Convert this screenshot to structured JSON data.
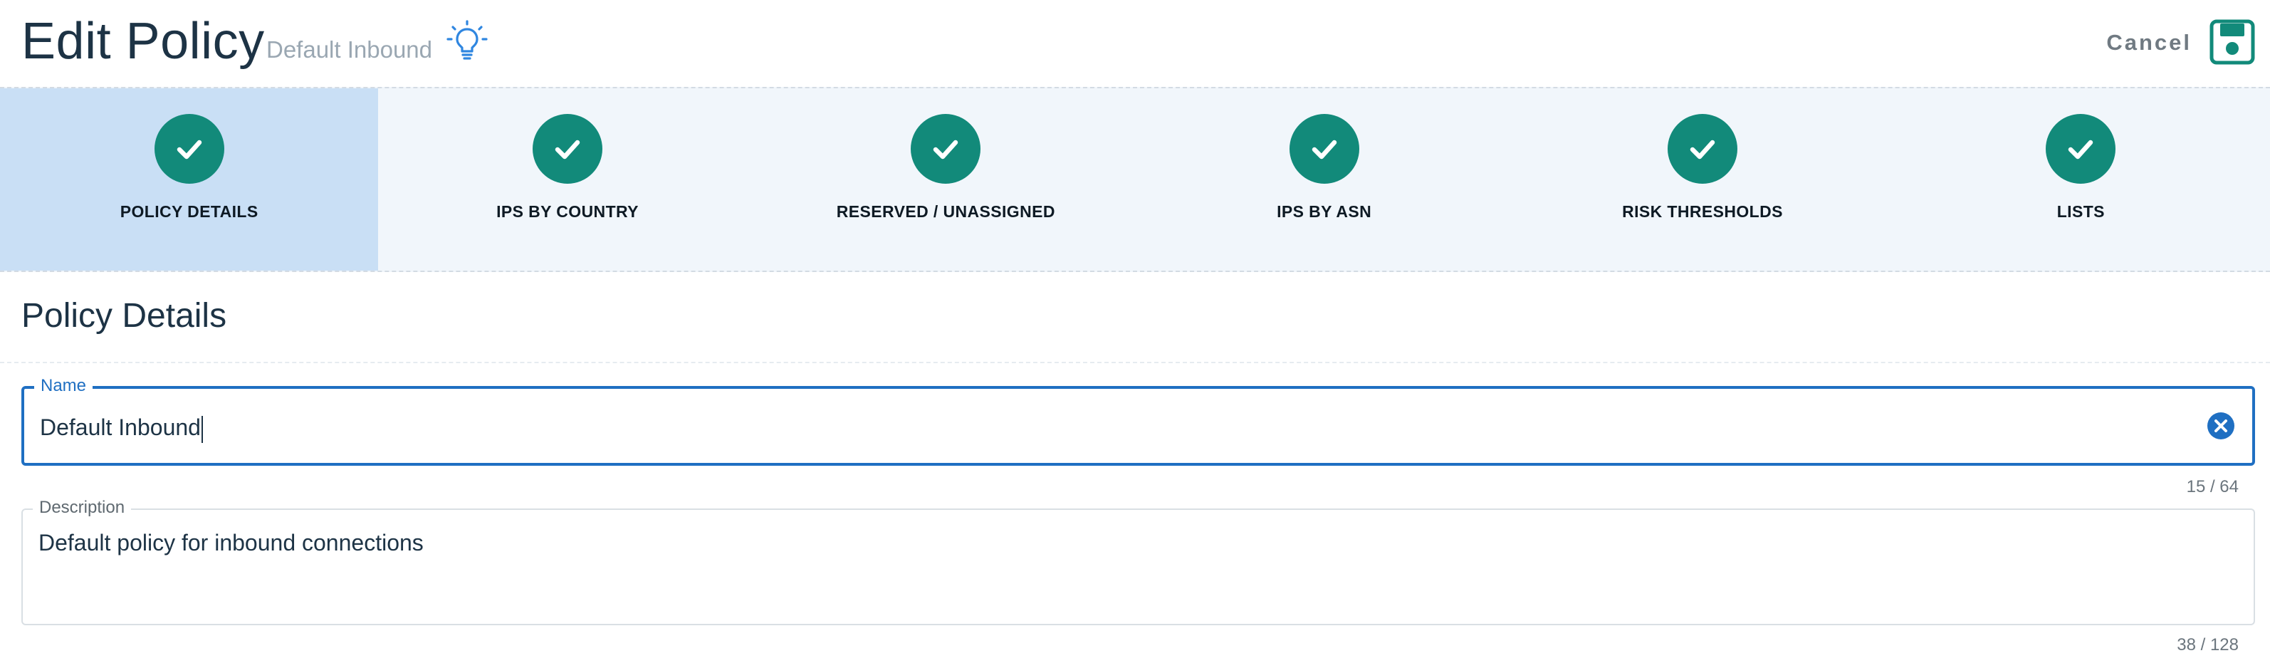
{
  "header": {
    "title": "Edit Policy",
    "subtitle": "Default Inbound",
    "hint_icon": "lightbulb-icon",
    "cancel_label": "Cancel",
    "save_icon": "floppy-disk-icon",
    "colors": {
      "accent": "#1f6fc2",
      "save": "#128a7a"
    }
  },
  "stepper": {
    "steps": [
      {
        "label": "POLICY DETAILS",
        "status": "complete",
        "active": true
      },
      {
        "label": "IPS BY COUNTRY",
        "status": "complete",
        "active": false
      },
      {
        "label": "RESERVED / UNASSIGNED",
        "status": "complete",
        "active": false
      },
      {
        "label": "IPS BY ASN",
        "status": "complete",
        "active": false
      },
      {
        "label": "RISK THRESHOLDS",
        "status": "complete",
        "active": false
      },
      {
        "label": "LISTS",
        "status": "complete",
        "active": false
      }
    ],
    "colors": {
      "complete": "#128a7a",
      "active_bg": "#c9dff5",
      "bg": "#f1f6fb"
    }
  },
  "section": {
    "title": "Policy Details"
  },
  "form": {
    "name": {
      "label": "Name",
      "value": "Default Inbound",
      "counter": "15 / 64"
    },
    "description": {
      "label": "Description",
      "value": "Default policy for inbound connections",
      "counter": "38 / 128"
    }
  }
}
